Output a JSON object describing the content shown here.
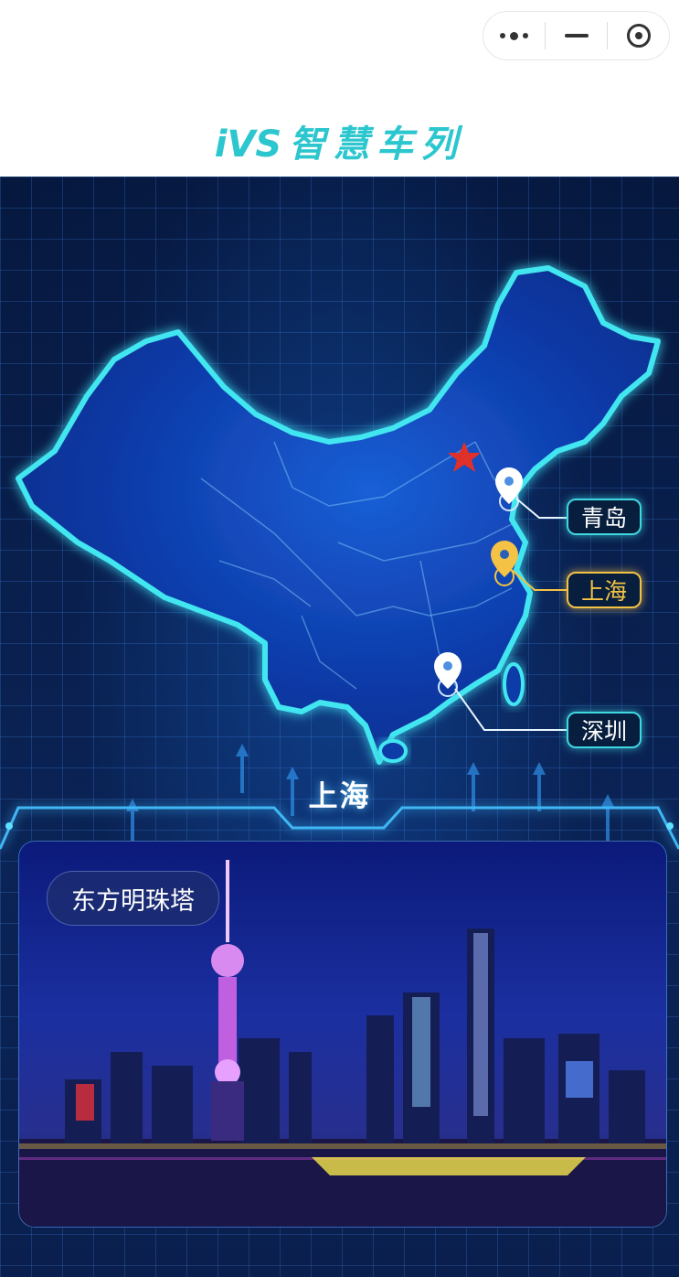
{
  "header": {
    "brand_logo": "iVS",
    "brand_title": "智慧车列",
    "capsule": {
      "more": "more-icon",
      "minimize": "minimize-icon",
      "close": "target-icon"
    }
  },
  "map": {
    "capital_marker": "star-icon",
    "cities": [
      {
        "name": "青岛",
        "active": false
      },
      {
        "name": "上海",
        "active": true
      },
      {
        "name": "深圳",
        "active": false
      }
    ],
    "colors": {
      "accent": "#3fd7e0",
      "active": "#f4c245",
      "star": "#e0302a"
    }
  },
  "panel": {
    "city_title": "上海",
    "photo_label": "东方明珠塔"
  }
}
